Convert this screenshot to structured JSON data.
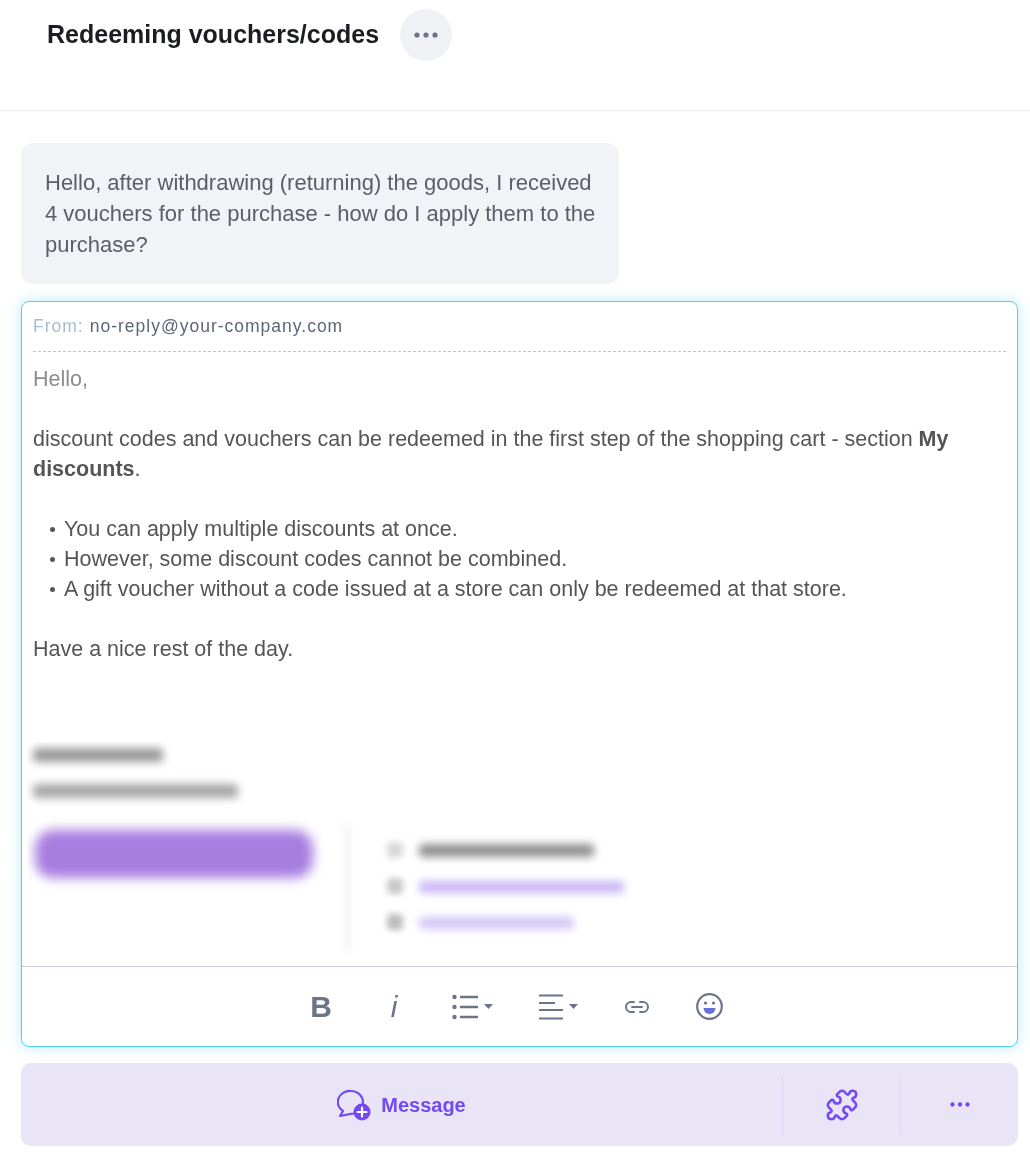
{
  "header": {
    "title": "Redeeming vouchers/codes"
  },
  "customer_message": {
    "text": "Hello, after withdrawing (returning) the goods, I received 4 vouchers for the purchase - how do I apply them to the purchase?"
  },
  "reply_editor": {
    "from_label": "From:",
    "from_address": "no-reply@your-company.com",
    "body": [
      {
        "kind": "greeting",
        "text": "Hello,"
      },
      {
        "kind": "paragraph",
        "text": "discount codes and vouchers can be redeemed in the first step of the shopping cart - section **My discounts**."
      },
      {
        "kind": "bullets",
        "items": [
          "You can apply multiple discounts at once.",
          "However, some discount codes cannot be combined.",
          "A gift voucher without a code issued at a store can only be redeemed at that store."
        ]
      },
      {
        "kind": "paragraph",
        "text": "Have a nice rest of the day."
      }
    ],
    "toolbar": [
      {
        "kind": "bold",
        "text": "B"
      },
      {
        "kind": "italic",
        "text": "i"
      },
      {
        "kind": "bulleted_list"
      },
      {
        "kind": "align"
      },
      {
        "kind": "link"
      },
      {
        "kind": "emoji"
      }
    ]
  },
  "composer_bar": {
    "message_button": "Message"
  }
}
